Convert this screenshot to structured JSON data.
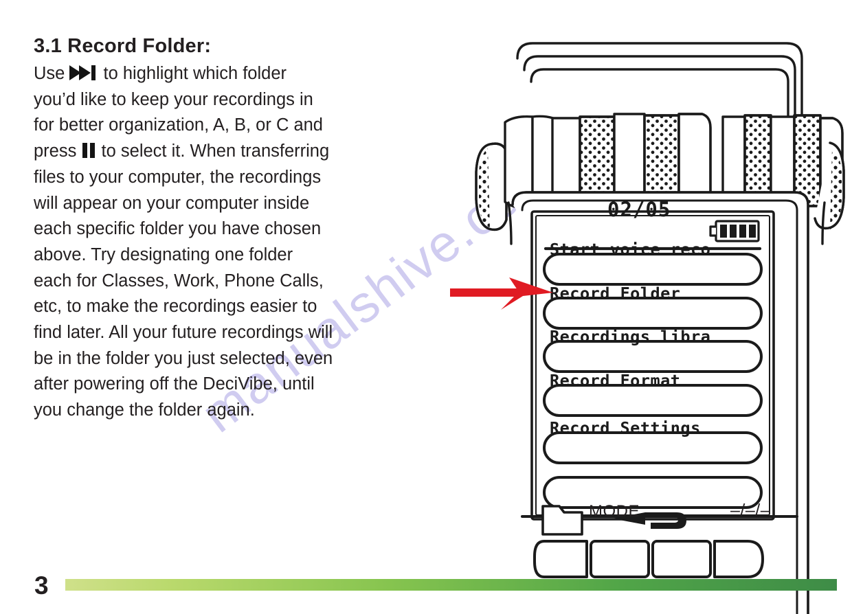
{
  "page": {
    "number": "3",
    "watermark": "manualshive.com",
    "footer_bar_color_start": "#cfe08a",
    "footer_bar_color_end": "#3e8c47"
  },
  "section": {
    "heading": "3.1 Record Folder:",
    "body_lines": [
      {
        "pre": "Use ",
        "icon": "next-track-icon",
        "post": " to highlight which folder"
      },
      {
        "pre": "you’d like to keep your recordings in",
        "icon": null,
        "post": ""
      },
      {
        "pre": "for better organization, A, B, or C and",
        "icon": null,
        "post": ""
      },
      {
        "pre": "press ",
        "icon": "pause-icon",
        "post": " to select it. When transferring"
      },
      {
        "pre": "files to your computer, the recordings",
        "icon": null,
        "post": ""
      },
      {
        "pre": "will appear on your computer inside",
        "icon": null,
        "post": ""
      },
      {
        "pre": "each specific folder you have chosen",
        "icon": null,
        "post": ""
      },
      {
        "pre": "above. Try designating one folder",
        "icon": null,
        "post": ""
      },
      {
        "pre": "each for Classes, Work, Phone Calls,",
        "icon": null,
        "post": ""
      },
      {
        "pre": "etc, to make the recordings easier to",
        "icon": null,
        "post": ""
      },
      {
        "pre": "find later. All your future recordings will",
        "icon": null,
        "post": ""
      },
      {
        "pre": "be in the folder you just selected, even",
        "icon": null,
        "post": ""
      },
      {
        "pre": "after powering off the DeciVibe, until",
        "icon": null,
        "post": ""
      },
      {
        "pre": "you change the folder again.",
        "icon": null,
        "post": ""
      }
    ]
  },
  "device": {
    "name": "DeciVibe voice recorder",
    "screen": {
      "status_counter": "02/05",
      "battery_icon": "battery-full-icon",
      "battery_bars": 4,
      "menu_items": [
        {
          "label": "Start voice reco",
          "highlighted": false
        },
        {
          "label": "Record Folder",
          "highlighted": true
        },
        {
          "label": "Recordings libra",
          "highlighted": false
        },
        {
          "label": "Record Format",
          "highlighted": false
        },
        {
          "label": "Record Settings",
          "highlighted": false
        },
        {
          "label": "",
          "highlighted": false
        }
      ]
    },
    "softkey_labels": [
      {
        "kind": "icon",
        "icon": "folder-icon",
        "text": ""
      },
      {
        "kind": "text",
        "icon": null,
        "text": "MODE"
      },
      {
        "kind": "icon",
        "icon": "return-arrow-icon",
        "text": ""
      },
      {
        "kind": "text",
        "icon": null,
        "text": "–/–/–"
      }
    ],
    "softkey_buttons": [
      "",
      "",
      "",
      ""
    ]
  },
  "annotation": {
    "pointer": "red-arrow-icon",
    "points_to": "Record Folder",
    "color": "#e01b23"
  }
}
